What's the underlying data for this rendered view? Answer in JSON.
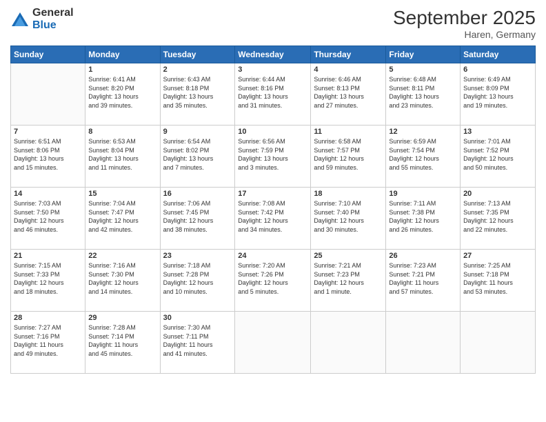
{
  "logo": {
    "general": "General",
    "blue": "Blue"
  },
  "title": "September 2025",
  "location": "Haren, Germany",
  "days_of_week": [
    "Sunday",
    "Monday",
    "Tuesday",
    "Wednesday",
    "Thursday",
    "Friday",
    "Saturday"
  ],
  "weeks": [
    [
      {
        "day": "",
        "info": ""
      },
      {
        "day": "1",
        "info": "Sunrise: 6:41 AM\nSunset: 8:20 PM\nDaylight: 13 hours\nand 39 minutes."
      },
      {
        "day": "2",
        "info": "Sunrise: 6:43 AM\nSunset: 8:18 PM\nDaylight: 13 hours\nand 35 minutes."
      },
      {
        "day": "3",
        "info": "Sunrise: 6:44 AM\nSunset: 8:16 PM\nDaylight: 13 hours\nand 31 minutes."
      },
      {
        "day": "4",
        "info": "Sunrise: 6:46 AM\nSunset: 8:13 PM\nDaylight: 13 hours\nand 27 minutes."
      },
      {
        "day": "5",
        "info": "Sunrise: 6:48 AM\nSunset: 8:11 PM\nDaylight: 13 hours\nand 23 minutes."
      },
      {
        "day": "6",
        "info": "Sunrise: 6:49 AM\nSunset: 8:09 PM\nDaylight: 13 hours\nand 19 minutes."
      }
    ],
    [
      {
        "day": "7",
        "info": "Sunrise: 6:51 AM\nSunset: 8:06 PM\nDaylight: 13 hours\nand 15 minutes."
      },
      {
        "day": "8",
        "info": "Sunrise: 6:53 AM\nSunset: 8:04 PM\nDaylight: 13 hours\nand 11 minutes."
      },
      {
        "day": "9",
        "info": "Sunrise: 6:54 AM\nSunset: 8:02 PM\nDaylight: 13 hours\nand 7 minutes."
      },
      {
        "day": "10",
        "info": "Sunrise: 6:56 AM\nSunset: 7:59 PM\nDaylight: 13 hours\nand 3 minutes."
      },
      {
        "day": "11",
        "info": "Sunrise: 6:58 AM\nSunset: 7:57 PM\nDaylight: 12 hours\nand 59 minutes."
      },
      {
        "day": "12",
        "info": "Sunrise: 6:59 AM\nSunset: 7:54 PM\nDaylight: 12 hours\nand 55 minutes."
      },
      {
        "day": "13",
        "info": "Sunrise: 7:01 AM\nSunset: 7:52 PM\nDaylight: 12 hours\nand 50 minutes."
      }
    ],
    [
      {
        "day": "14",
        "info": "Sunrise: 7:03 AM\nSunset: 7:50 PM\nDaylight: 12 hours\nand 46 minutes."
      },
      {
        "day": "15",
        "info": "Sunrise: 7:04 AM\nSunset: 7:47 PM\nDaylight: 12 hours\nand 42 minutes."
      },
      {
        "day": "16",
        "info": "Sunrise: 7:06 AM\nSunset: 7:45 PM\nDaylight: 12 hours\nand 38 minutes."
      },
      {
        "day": "17",
        "info": "Sunrise: 7:08 AM\nSunset: 7:42 PM\nDaylight: 12 hours\nand 34 minutes."
      },
      {
        "day": "18",
        "info": "Sunrise: 7:10 AM\nSunset: 7:40 PM\nDaylight: 12 hours\nand 30 minutes."
      },
      {
        "day": "19",
        "info": "Sunrise: 7:11 AM\nSunset: 7:38 PM\nDaylight: 12 hours\nand 26 minutes."
      },
      {
        "day": "20",
        "info": "Sunrise: 7:13 AM\nSunset: 7:35 PM\nDaylight: 12 hours\nand 22 minutes."
      }
    ],
    [
      {
        "day": "21",
        "info": "Sunrise: 7:15 AM\nSunset: 7:33 PM\nDaylight: 12 hours\nand 18 minutes."
      },
      {
        "day": "22",
        "info": "Sunrise: 7:16 AM\nSunset: 7:30 PM\nDaylight: 12 hours\nand 14 minutes."
      },
      {
        "day": "23",
        "info": "Sunrise: 7:18 AM\nSunset: 7:28 PM\nDaylight: 12 hours\nand 10 minutes."
      },
      {
        "day": "24",
        "info": "Sunrise: 7:20 AM\nSunset: 7:26 PM\nDaylight: 12 hours\nand 5 minutes."
      },
      {
        "day": "25",
        "info": "Sunrise: 7:21 AM\nSunset: 7:23 PM\nDaylight: 12 hours\nand 1 minute."
      },
      {
        "day": "26",
        "info": "Sunrise: 7:23 AM\nSunset: 7:21 PM\nDaylight: 11 hours\nand 57 minutes."
      },
      {
        "day": "27",
        "info": "Sunrise: 7:25 AM\nSunset: 7:18 PM\nDaylight: 11 hours\nand 53 minutes."
      }
    ],
    [
      {
        "day": "28",
        "info": "Sunrise: 7:27 AM\nSunset: 7:16 PM\nDaylight: 11 hours\nand 49 minutes."
      },
      {
        "day": "29",
        "info": "Sunrise: 7:28 AM\nSunset: 7:14 PM\nDaylight: 11 hours\nand 45 minutes."
      },
      {
        "day": "30",
        "info": "Sunrise: 7:30 AM\nSunset: 7:11 PM\nDaylight: 11 hours\nand 41 minutes."
      },
      {
        "day": "",
        "info": ""
      },
      {
        "day": "",
        "info": ""
      },
      {
        "day": "",
        "info": ""
      },
      {
        "day": "",
        "info": ""
      }
    ]
  ]
}
